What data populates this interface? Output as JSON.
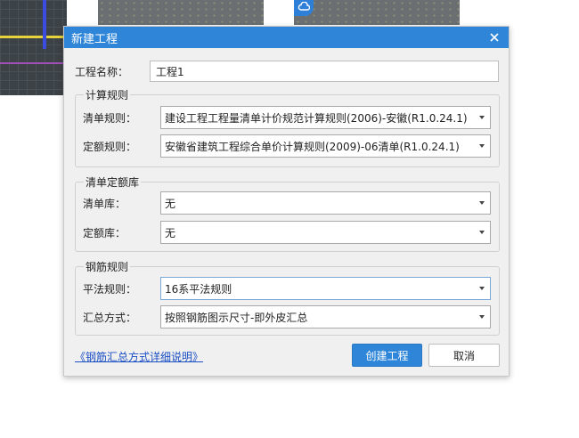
{
  "background": {
    "cloud_badge_icon": "cloud-icon"
  },
  "dialog": {
    "title": "新建工程",
    "close_icon": "close-icon",
    "project_name": {
      "label": "工程名称：",
      "value": "工程1"
    },
    "calc_rules": {
      "title": "计算规则",
      "bill_rule": {
        "label": "清单规则：",
        "value": "建设工程工程量清单计价规范计算规则(2006)-安徽(R1.0.24.1)"
      },
      "quota_rule": {
        "label": "定额规则：",
        "value": "安徽省建筑工程综合单价计算规则(2009)-06清单(R1.0.24.1)"
      }
    },
    "bill_quota_lib": {
      "title": "清单定额库",
      "bill_lib": {
        "label": "清单库：",
        "value": "无"
      },
      "quota_lib": {
        "label": "定额库：",
        "value": "无"
      }
    },
    "rebar_rules": {
      "title": "钢筋规则",
      "flat_rule": {
        "label": "平法规则：",
        "value": "16系平法规则"
      },
      "summary_method": {
        "label": "汇总方式：",
        "value": "按照钢筋图示尺寸-即外皮汇总"
      }
    },
    "help_link": "《钢筋汇总方式详细说明》",
    "create_button": "创建工程",
    "cancel_button": "取消"
  },
  "colors": {
    "titlebar": "#2f86d8",
    "primary_button": "#2f86d8",
    "link": "#1a4fc4"
  }
}
